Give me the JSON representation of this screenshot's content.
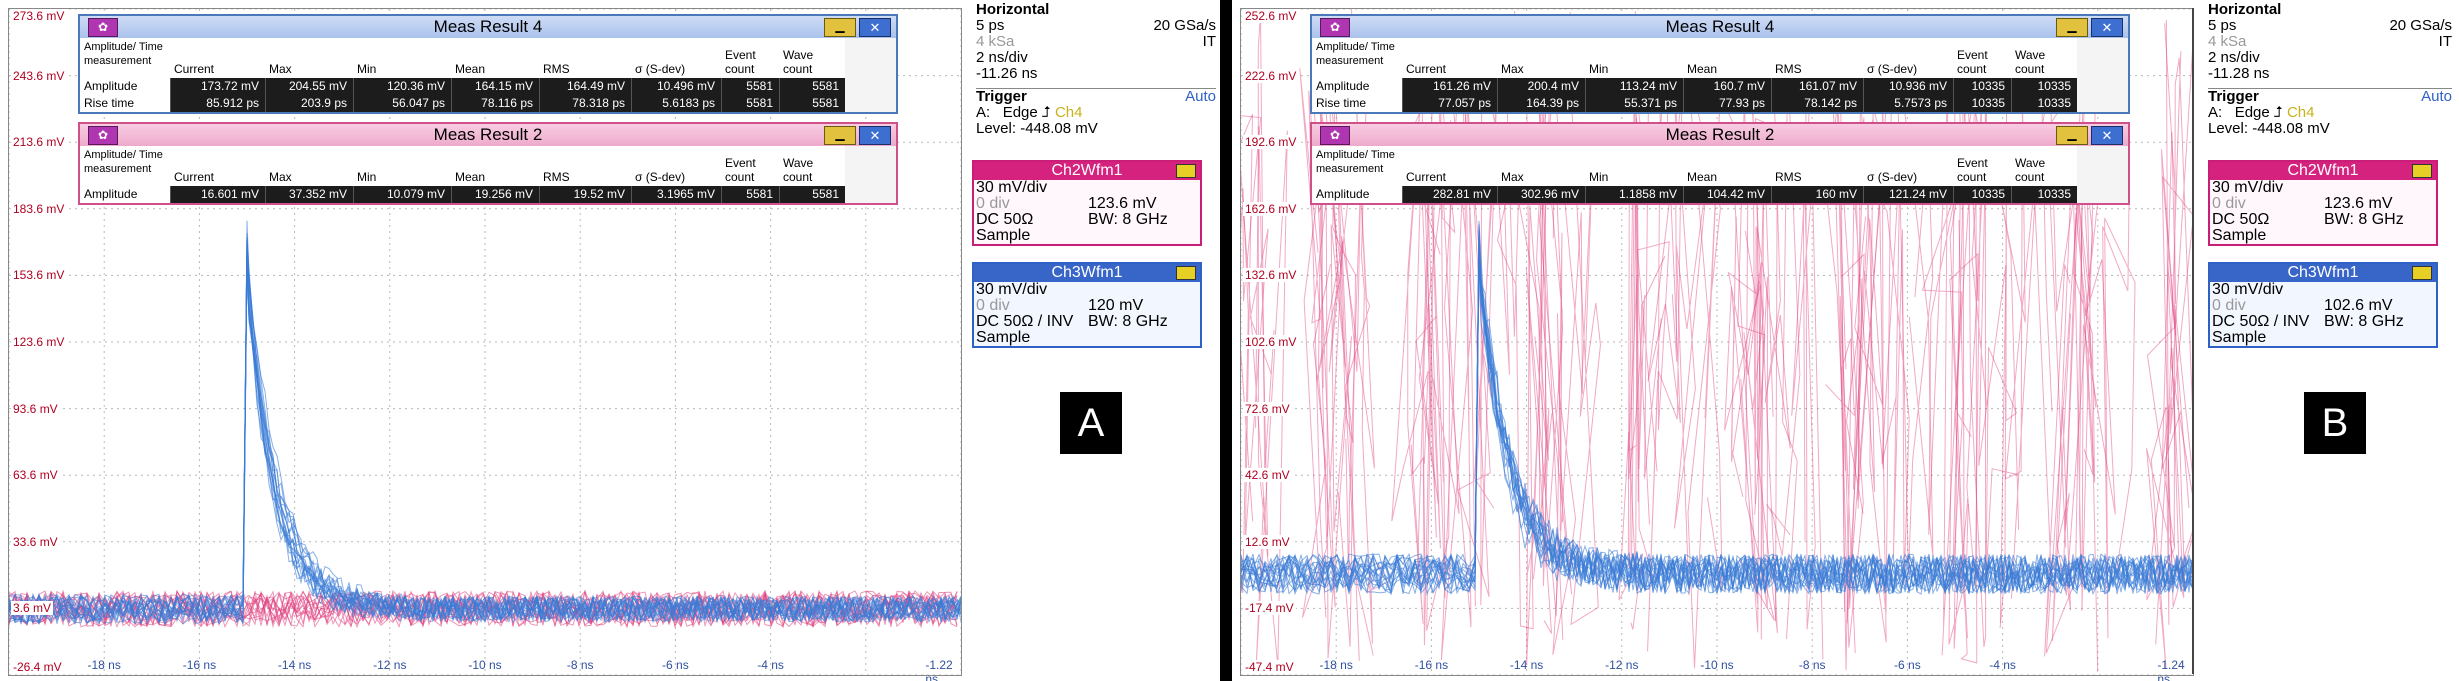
{
  "panels": [
    {
      "id": "A",
      "letter": "A",
      "y_labels": [
        "273.6 mV",
        "243.6 mV",
        "213.6 mV",
        "183.6 mV",
        "153.6 mV",
        "123.6 mV",
        "93.6 mV",
        "63.6 mV",
        "33.6 mV",
        "3.6 mV",
        "-26.4 mV"
      ],
      "x_labels": [
        "-18 ns",
        "-16 ns",
        "-14 ns",
        "-12 ns",
        "-10 ns",
        "-8 ns",
        "-6 ns",
        "-4 ns",
        "-1.22 ns"
      ],
      "meas4": {
        "title": "Meas Result 4",
        "headers": [
          "Amplitude/ Time measurement",
          "Current",
          "Max",
          "Min",
          "Mean",
          "RMS",
          "σ (S-dev)",
          "Event count",
          "Wave count"
        ],
        "rows": [
          {
            "label": "Amplitude",
            "values": [
              "173.72 mV",
              "204.55 mV",
              "120.36 mV",
              "164.15 mV",
              "164.49 mV",
              "10.496 mV",
              "5581",
              "5581"
            ]
          },
          {
            "label": "Rise time",
            "values": [
              "85.912 ps",
              "203.9 ps",
              "56.047 ps",
              "78.116 ps",
              "78.318 ps",
              "5.6183 ps",
              "5581",
              "5581"
            ]
          }
        ]
      },
      "meas2": {
        "title": "Meas Result 2",
        "headers": [
          "Amplitude/ Time measurement",
          "Current",
          "Max",
          "Min",
          "Mean",
          "RMS",
          "σ (S-dev)",
          "Event count",
          "Wave count"
        ],
        "rows": [
          {
            "label": "Amplitude",
            "values": [
              "16.601 mV",
              "37.352 mV",
              "10.079 mV",
              "19.256 mV",
              "19.52 mV",
              "3.1965 mV",
              "5581",
              "5581"
            ]
          }
        ]
      },
      "horizontal": {
        "title": "Horizontal",
        "scale": "5 ps",
        "rate": "20 GSa/s",
        "samples": "4 kSa",
        "mode": "IT",
        "div": "2 ns/div",
        "pos": "-11.26 ns"
      },
      "trigger": {
        "title": "Trigger",
        "mode": "Auto",
        "source_label": "A:",
        "type": "Edge",
        "channel": "Ch4",
        "level": "Level: -448.08 mV"
      },
      "ch2": {
        "title": "Ch2Wfm1",
        "scale": "30 mV/div",
        "offset": "0 div",
        "value": "123.6 mV",
        "coupling": "DC 50Ω",
        "bw": "BW: 8 GHz",
        "acq": "Sample"
      },
      "ch3": {
        "title": "Ch3Wfm1",
        "scale": "30 mV/div",
        "offset": "0 div",
        "value": "120 mV",
        "coupling": "DC 50Ω / INV",
        "bw": "BW: 8 GHz",
        "acq": "Sample"
      }
    },
    {
      "id": "B",
      "letter": "B",
      "y_labels": [
        "252.6 mV",
        "222.6 mV",
        "192.6 mV",
        "162.6 mV",
        "132.6 mV",
        "102.6 mV",
        "72.6 mV",
        "42.6 mV",
        "12.6 mV",
        "-17.4 mV",
        "-47.4 mV"
      ],
      "x_labels": [
        "-18 ns",
        "-16 ns",
        "-14 ns",
        "-12 ns",
        "-10 ns",
        "-8 ns",
        "-6 ns",
        "-4 ns",
        "-1.24 ns"
      ],
      "meas4": {
        "title": "Meas Result 4",
        "headers": [
          "Amplitude/ Time measurement",
          "Current",
          "Max",
          "Min",
          "Mean",
          "RMS",
          "σ (S-dev)",
          "Event count",
          "Wave count"
        ],
        "rows": [
          {
            "label": "Amplitude",
            "values": [
              "161.26 mV",
              "200.4 mV",
              "113.24 mV",
              "160.7 mV",
              "161.07 mV",
              "10.936 mV",
              "10335",
              "10335"
            ]
          },
          {
            "label": "Rise time",
            "values": [
              "77.057 ps",
              "164.39 ps",
              "55.371 ps",
              "77.93 ps",
              "78.142 ps",
              "5.7573 ps",
              "10335",
              "10335"
            ]
          }
        ]
      },
      "meas2": {
        "title": "Meas Result 2",
        "headers": [
          "Amplitude/ Time measurement",
          "Current",
          "Max",
          "Min",
          "Mean",
          "RMS",
          "σ (S-dev)",
          "Event count",
          "Wave count"
        ],
        "rows": [
          {
            "label": "Amplitude",
            "values": [
              "282.81 mV",
              "302.96 mV",
              "1.1858 mV",
              "104.42 mV",
              "160 mV",
              "121.24 mV",
              "10335",
              "10335"
            ]
          }
        ]
      },
      "horizontal": {
        "title": "Horizontal",
        "scale": "5 ps",
        "rate": "20 GSa/s",
        "samples": "4 kSa",
        "mode": "IT",
        "div": "2 ns/div",
        "pos": "-11.28 ns"
      },
      "trigger": {
        "title": "Trigger",
        "mode": "Auto",
        "source_label": "A:",
        "type": "Edge",
        "channel": "Ch4",
        "level": "Level: -448.08 mV"
      },
      "ch2": {
        "title": "Ch2Wfm1",
        "scale": "30 mV/div",
        "offset": "0 div",
        "value": "123.6 mV",
        "coupling": "DC 50Ω",
        "bw": "BW: 8 GHz",
        "acq": "Sample"
      },
      "ch3": {
        "title": "Ch3Wfm1",
        "scale": "30 mV/div",
        "offset": "0 div",
        "value": "102.6 mV",
        "coupling": "DC 50Ω / INV",
        "bw": "BW: 8 GHz",
        "acq": "Sample"
      }
    }
  ],
  "colors": {
    "ch2": "#e0407f",
    "ch3": "#3a7bd5",
    "grid": "#b8b8b8",
    "label": "#b00020"
  }
}
